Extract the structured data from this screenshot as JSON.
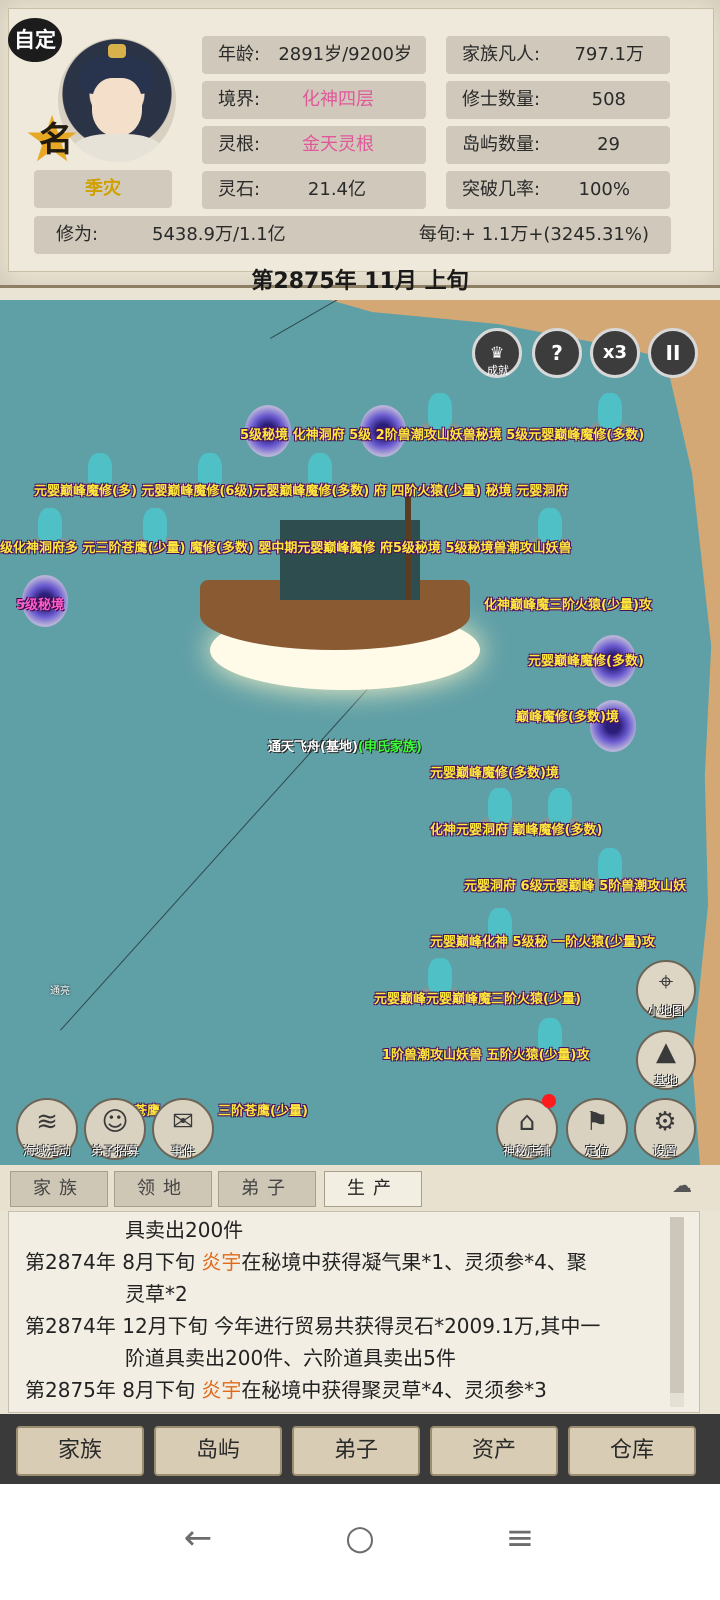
{
  "header": {
    "custom_badge": "自定",
    "fame_char": "名",
    "character_name": "季灾",
    "stats": {
      "age_label": "年龄:",
      "age_value": "2891岁/9200岁",
      "realm_label": "境界:",
      "realm_value": "化神四层",
      "root_label": "灵根:",
      "root_value": "金天灵根",
      "stone_label": "灵石:",
      "stone_value": "21.4亿",
      "clan_label": "家族凡人:",
      "clan_value": "797.1万",
      "cultivator_label": "修士数量:",
      "cultivator_value": "508",
      "island_label": "岛屿数量:",
      "island_value": "29",
      "breakthrough_label": "突破几率:",
      "breakthrough_value": "100%"
    },
    "cultivation_label": "修为:",
    "cultivation_value": "5438.9万/1.1亿",
    "per_period": "每旬:+ 1.1万+(3245.31%)",
    "date": "第2875年 11月 上旬"
  },
  "map": {
    "controls": {
      "achievement": "成就",
      "help": "?",
      "speed": "x3",
      "pause": "II"
    },
    "labels": [
      "5级秘境 化神洞府 5级  2阶兽潮攻山妖兽秘境 5级元婴巅峰魔修(多数)",
      "元婴巅峰魔修(多) 元婴巅峰魔修(6级)元婴巅峰魔修(多数) 府  四阶火猿(少量) 秘境 元婴洞府",
      "级化神洞府多 元三阶苍鹰(少量) 魔修(多数) 婴中期元婴巅峰魔修 府5级秘境 5级秘境兽潮攻山妖兽",
      "5级秘境",
      "化神巅峰魔三阶火猿(少量)攻",
      "元婴巅峰魔修(多数)",
      "巅峰魔修(多数)境",
      "元婴巅峰魔修(多数)境",
      "化神元婴洞府 巅峰魔修(多数)",
      "元婴洞府 6级元婴巅峰 5阶兽潮攻山妖",
      "元婴巅峰化神 5级秘 一阶火猿(少量)攻",
      "元婴巅峰元婴巅峰魔三阶火猿(少量)",
      "1阶兽潮攻山妖兽 五阶火猿(少量)攻",
      "苍鹰",
      "三阶苍鹰(少量)"
    ],
    "ship_name": "通天飞舟(基地)",
    "ship_clan": "(申氏家族)",
    "small_label": "通亮",
    "side_buttons": {
      "minimap": "小地图",
      "base": "基地"
    },
    "bottom_buttons": {
      "sea_event": "海域活动",
      "recruit": "弟子招募",
      "events": "事件",
      "shop": "神秘店铺",
      "locate": "定位",
      "settings": "设置"
    }
  },
  "tabs": [
    "家族",
    "领地",
    "弟子",
    "生产"
  ],
  "active_tab": "生产",
  "log": {
    "l1": "具卖出200件",
    "l2_year": "第2874年",
    "l2_pre": "8月下旬 ",
    "l2_name": "炎宇",
    "l2_post": "在秘境中获得凝气果*1、灵须参*4、聚",
    "l3": "灵草*2",
    "l4_year": "第2874年",
    "l4_text": "12月下旬 今年进行贸易共获得灵石*2009.1万,其中一",
    "l5": "阶道具卖出200件、六阶道具卖出5件",
    "l6_year": "第2875年",
    "l6_pre": "8月下旬 ",
    "l6_name": "炎宇",
    "l6_post": "在秘境中获得聚灵草*4、灵须参*3"
  },
  "bottom_nav": [
    "家族",
    "岛屿",
    "弟子",
    "资产",
    "仓库"
  ],
  "colors": {
    "realm": "#e0589a",
    "highlight": "#e06a18",
    "sea": "#5f9fa6",
    "clan": "#3cff3c"
  }
}
